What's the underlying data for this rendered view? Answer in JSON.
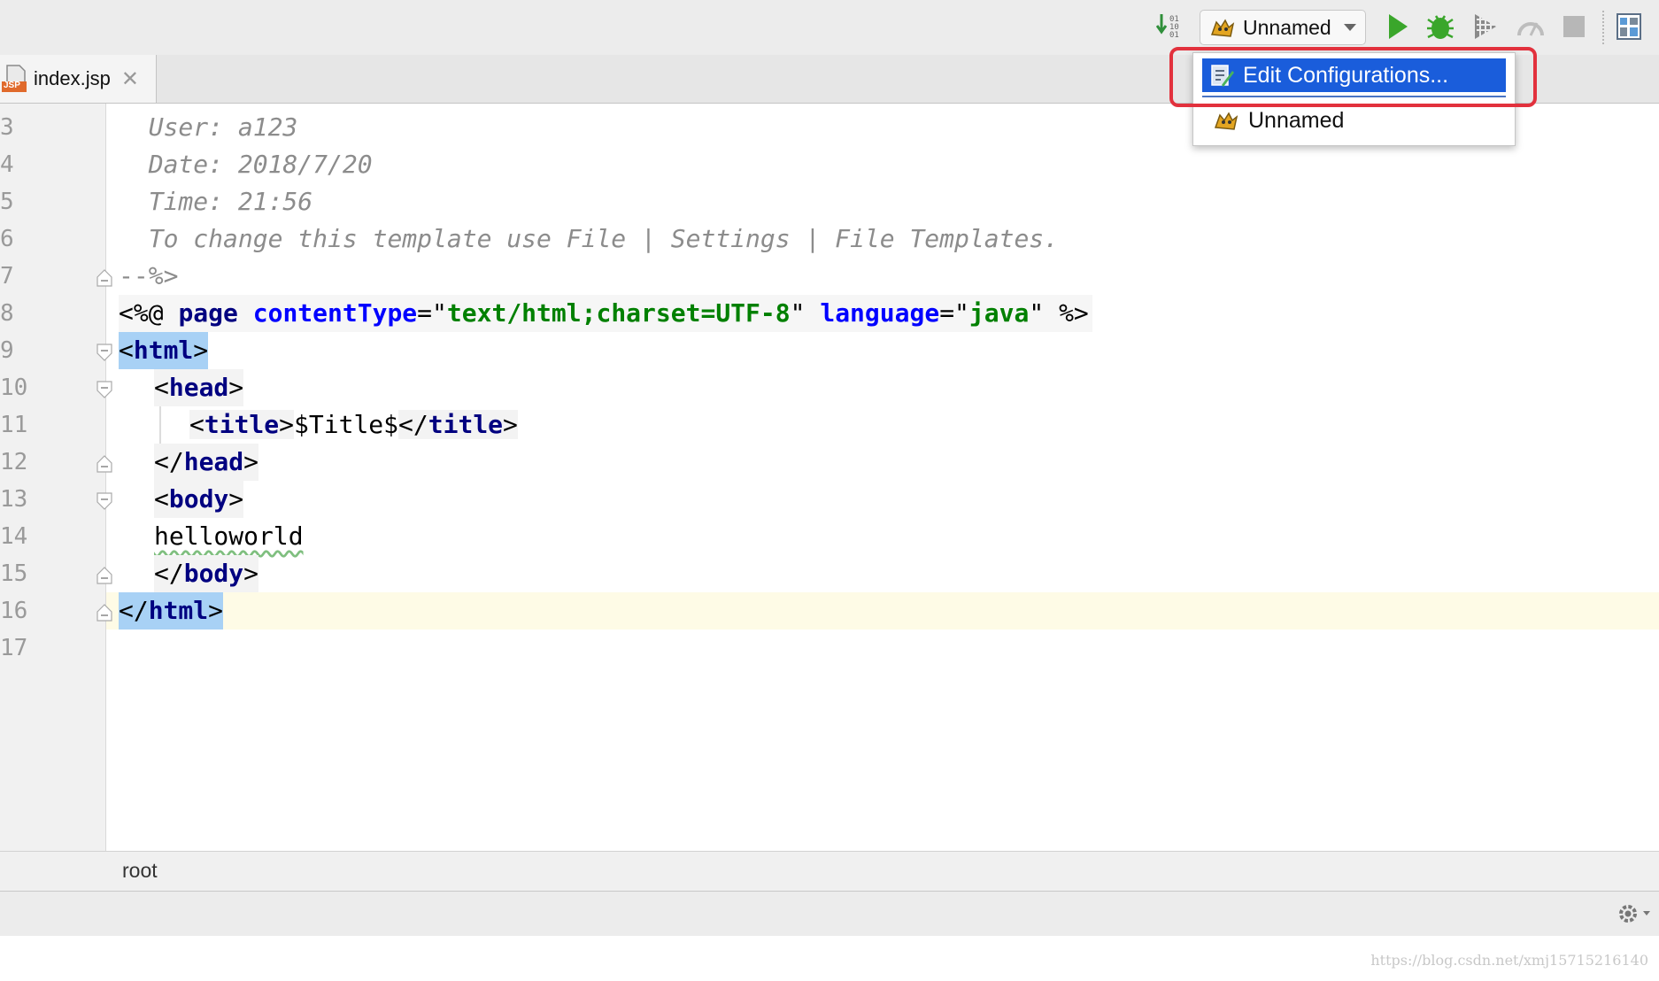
{
  "toolbar": {
    "run_config": "Unnamed"
  },
  "tabs": [
    {
      "label": "index.jsp",
      "icon_badge": "JSP"
    }
  ],
  "run_menu": {
    "items": [
      {
        "label": "Edit Configurations...",
        "selected": true
      },
      {
        "label": "Unnamed",
        "selected": false
      }
    ]
  },
  "editor": {
    "line_numbers": [
      "3",
      "4",
      "5",
      "6",
      "7",
      "8",
      "9",
      "10",
      "11",
      "12",
      "13",
      "14",
      "15",
      "16",
      "17"
    ],
    "lines": [
      {
        "indent": "  ",
        "text": "User: a123"
      },
      {
        "indent": "  ",
        "text": "Date: 2018/7/20"
      },
      {
        "indent": "  ",
        "text": "Time: 21:56"
      },
      {
        "indent": "  ",
        "text": "To change this template use File | Settings | File Templates."
      },
      {
        "text": "--%>"
      },
      {
        "open": "<%@ ",
        "directive": "page",
        "sp1": " ",
        "attr1": "contentType",
        "eq1": "=\"",
        "val1": "text/html;charset=UTF-8",
        "q1": "\" ",
        "attr2": "language",
        "eq2": "=\"",
        "val2": "java",
        "close": "\" %>"
      },
      {
        "open": "<",
        "tag": "html",
        "close": ">"
      },
      {
        "open": "<",
        "tag": "head",
        "close": ">"
      },
      {
        "open1": "<",
        "tag1": "title",
        "close1": ">",
        "text": "$Title$",
        "open2": "</",
        "tag2": "title",
        "close2": ">"
      },
      {
        "open": "</",
        "tag": "head",
        "close": ">"
      },
      {
        "open": "<",
        "tag": "body",
        "close": ">"
      },
      {
        "text": "helloworld"
      },
      {
        "open": "</",
        "tag": "body",
        "close": ">"
      },
      {
        "open": "</",
        "tag": "html",
        "close": ">"
      }
    ]
  },
  "status": {
    "breadcrumb": "root"
  },
  "watermark": "https://blog.csdn.net/xmj15715216140",
  "icons": [
    "update-icon",
    "tomcat-icon",
    "dropdown-arrow-icon",
    "run-icon",
    "debug-icon",
    "coverage-icon",
    "profile-icon",
    "stop-icon",
    "project-structure-icon",
    "jsp-file-icon",
    "close-icon",
    "edit-config-icon",
    "fold-icon",
    "gear-icon"
  ],
  "colors": {
    "selection": "#1a5ddb",
    "highlight_box": "#e2313d",
    "run_green": "#3aa62b",
    "tag_highlight": "#a8d1f5",
    "current_line": "#fefbe6"
  }
}
